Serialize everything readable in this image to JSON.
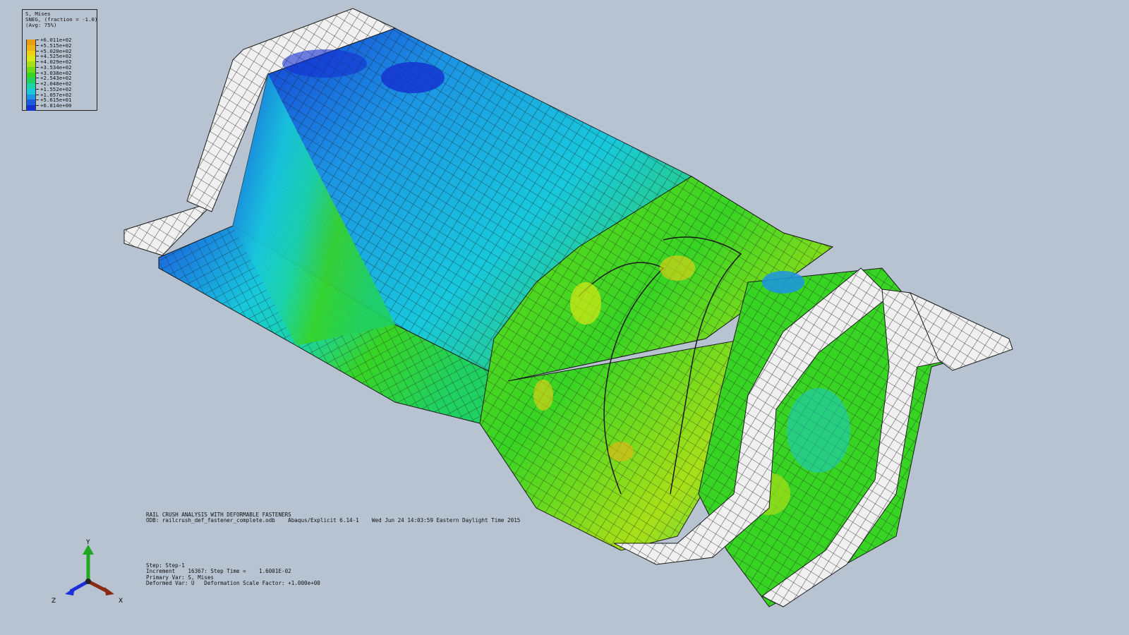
{
  "legend": {
    "header": [
      "S, Mises",
      "SNEG, (fraction = -1.0)",
      "(Avg: 75%)"
    ],
    "entries": [
      {
        "value": "+6.011e+02",
        "color": "#e89c10"
      },
      {
        "value": "+5.515e+02",
        "color": "#ecb418"
      },
      {
        "value": "+5.020e+02",
        "color": "#f0d016"
      },
      {
        "value": "+4.525e+02",
        "color": "#d8e816"
      },
      {
        "value": "+4.029e+02",
        "color": "#a8e018"
      },
      {
        "value": "+3.534e+02",
        "color": "#6cdc1a"
      },
      {
        "value": "+3.038e+02",
        "color": "#38d424"
      },
      {
        "value": "+2.543e+02",
        "color": "#20d060"
      },
      {
        "value": "+2.048e+02",
        "color": "#1ad4a8"
      },
      {
        "value": "+1.552e+02",
        "color": "#18c8dc"
      },
      {
        "value": "+1.057e+02",
        "color": "#1c94e4"
      },
      {
        "value": "+5.615e+01",
        "color": "#1a5ce0"
      },
      {
        "value": "+6.814e+00",
        "color": "#1430d0"
      }
    ]
  },
  "title_block": {
    "line1": "RAIL CRUSH ANALYSIS WITH DEFORMABLE FASTENERS",
    "line2": "ODB: railcrush_def_fastener_complete.odb    Abaqus/Explicit 6.14-1    Wed Jun 24 14:03:59 Eastern Daylight Time 2015"
  },
  "step_block": {
    "step": "Step: Step-1",
    "increment": "Increment    16367: Step Time =    1.6001E-02",
    "primary_var": "Primary Var: S, Mises",
    "deformed_var": "Deformed Var: U   Deformation Scale Factor: +1.000e+00"
  },
  "triad": {
    "y_label": "Y",
    "z_label": "Z",
    "x_label": "X",
    "y_color": "#1fa81f",
    "z_color": "#1a30d8",
    "x_color": "#8a2a14"
  },
  "colors": {
    "background": "#b8c3d1",
    "flange_white": "#f0f0f0",
    "mesh_line": "#1a1a1a"
  }
}
